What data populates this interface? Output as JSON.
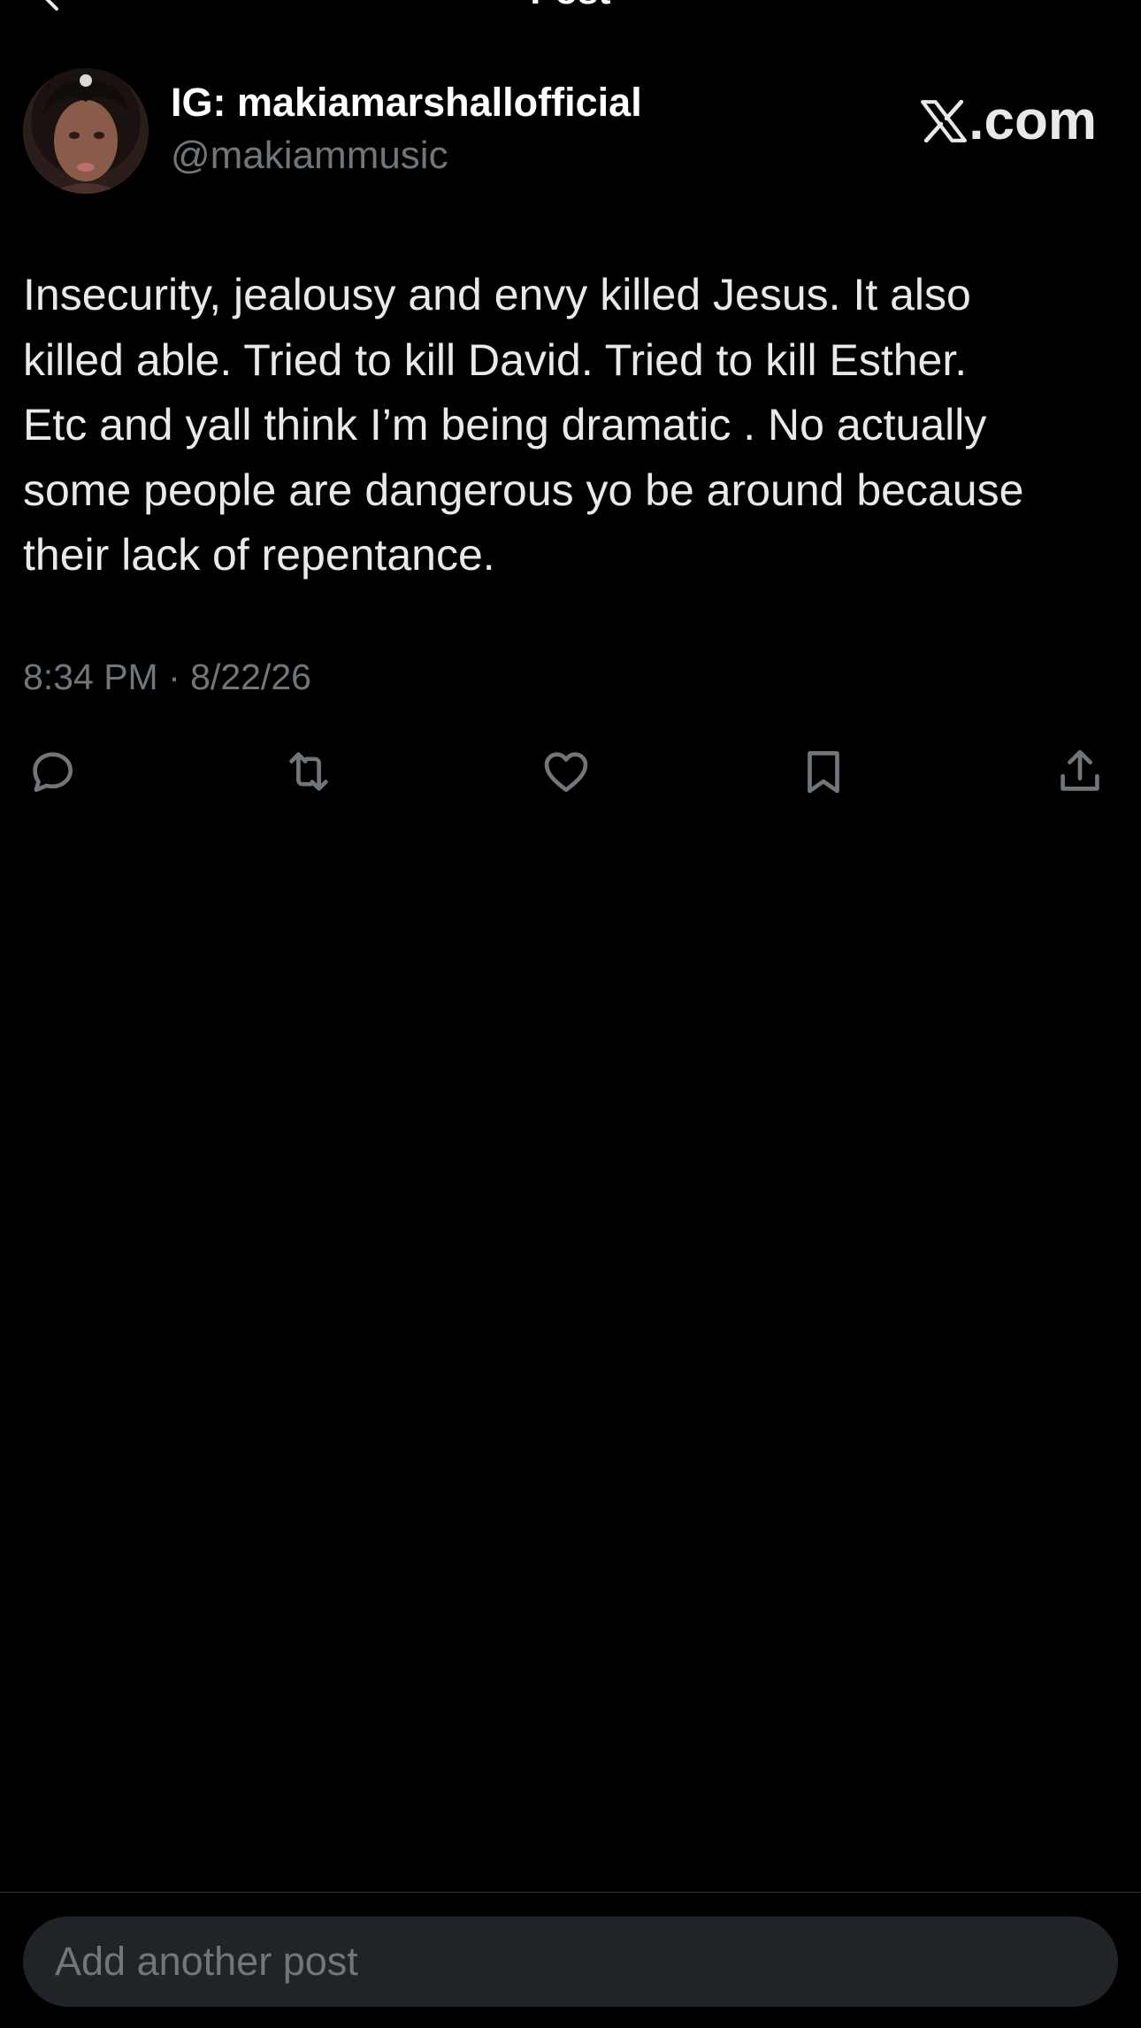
{
  "header": {
    "title": "Post"
  },
  "author": {
    "display_name": "IG: makiamarshallofficial",
    "handle": "@makiammusic",
    "avatar_icon": "profile-photo"
  },
  "watermark": {
    "label": ".com",
    "icon": "x-logo-icon"
  },
  "post": {
    "text": "Insecurity, jealousy and envy killed Jesus. It also\nkilled able. Tried to kill David. Tried to kill Esther.\nEtc and yall think I’m being dramatic . No actually\nsome people are dangerous yo be around because\ntheir lack of repentance.",
    "timestamp": "8:34 PM · 8/22/26"
  },
  "actions": [
    {
      "name": "reply",
      "icon": "reply-icon"
    },
    {
      "name": "repost",
      "icon": "repost-icon"
    },
    {
      "name": "like",
      "icon": "heart-icon"
    },
    {
      "name": "bookmark",
      "icon": "bookmark-icon"
    },
    {
      "name": "share",
      "icon": "share-icon"
    }
  ],
  "composer": {
    "placeholder": "Add another post"
  },
  "colors": {
    "background": "#000000",
    "text_primary": "#e7e9ea",
    "text_secondary": "#71767b",
    "composer_bg": "#202327",
    "divider": "#2f3336"
  }
}
